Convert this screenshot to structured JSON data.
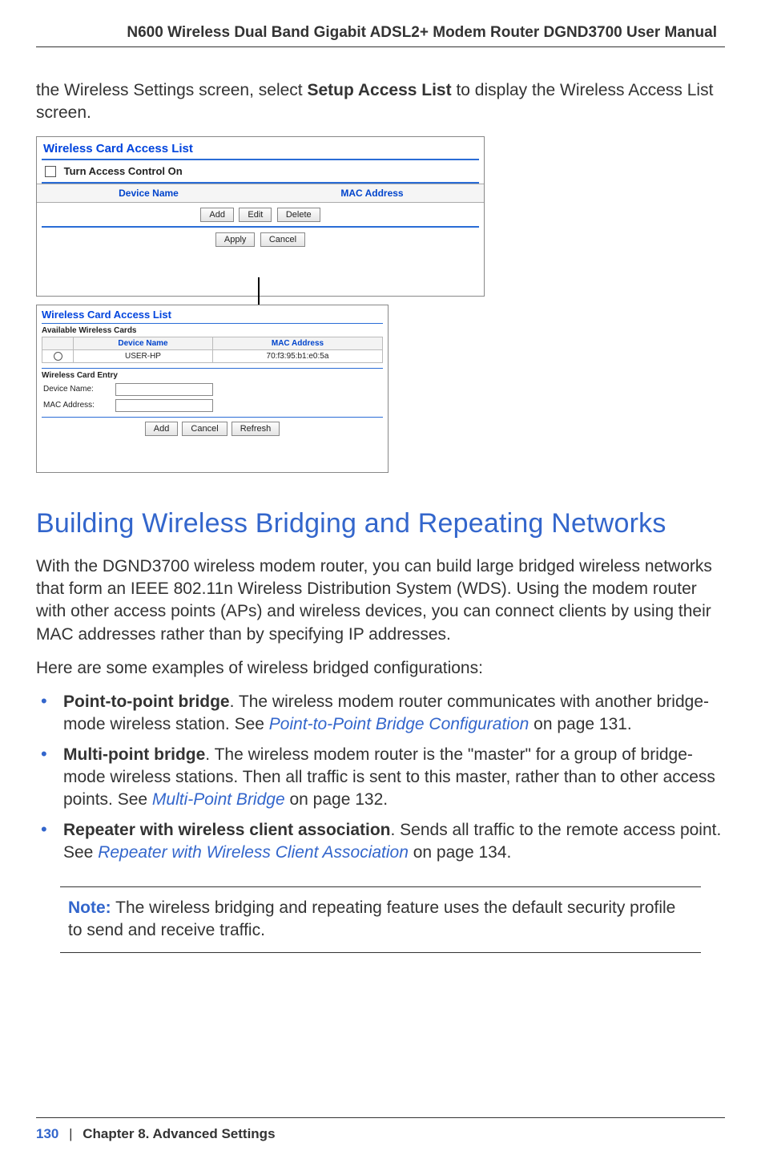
{
  "header": {
    "title": "N600 Wireless Dual Band Gigabit ADSL2+ Modem Router DGND3700 User Manual"
  },
  "intro": {
    "pre": "the Wireless Settings screen, select ",
    "bold": "Setup Access List",
    "post": " to display the Wireless Access List screen."
  },
  "panel1": {
    "title": "Wireless Card Access List",
    "checkbox_label": "Turn Access Control On",
    "col_device": "Device Name",
    "col_mac": "MAC Address",
    "btn_add": "Add",
    "btn_edit": "Edit",
    "btn_delete": "Delete",
    "btn_apply": "Apply",
    "btn_cancel": "Cancel"
  },
  "panel2": {
    "title": "Wireless Card Access List",
    "sub_available": "Available Wireless Cards",
    "col_device": "Device Name",
    "col_mac": "MAC Address",
    "row_device": "USER-HP",
    "row_mac": "70:f3:95:b1:e0:5a",
    "sub_entry": "Wireless Card Entry",
    "lbl_device": "Device Name:",
    "lbl_mac": "MAC Address:",
    "btn_add": "Add",
    "btn_cancel": "Cancel",
    "btn_refresh": "Refresh"
  },
  "section_heading": "Building Wireless Bridging and Repeating Networks",
  "para1": "With the DGND3700 wireless modem router, you can build large bridged wireless networks that form an IEEE 802.11n Wireless Distribution System (WDS). Using the modem router with other access points (APs) and wireless devices, you can connect clients by using their MAC addresses rather than by specifying IP addresses.",
  "para2": "Here are some examples of wireless bridged configurations:",
  "bullets": [
    {
      "bold": "Point-to-point bridge",
      "text1": ". The wireless modem router communicates with another bridge-mode wireless station. See ",
      "link": "Point-to-Point Bridge Configuration",
      "text2": " on page 131."
    },
    {
      "bold": "Multi-point bridge",
      "text1": ". The wireless modem router is the \"master\" for a group of bridge-mode wireless stations. Then all traffic is sent to this master, rather than to other access points. See ",
      "link": "Multi-Point Bridge",
      "text2": " on page 132."
    },
    {
      "bold": "Repeater with wireless client association",
      "text1": ". Sends all traffic to the remote access point. See ",
      "link": "Repeater with Wireless Client Association",
      "text2": " on page 134."
    }
  ],
  "note": {
    "label": "Note:",
    "text": "  The wireless bridging and repeating feature uses the default security profile to send and receive traffic."
  },
  "footer": {
    "page": "130",
    "sep": "|",
    "chapter": "Chapter 8.  Advanced Settings"
  }
}
